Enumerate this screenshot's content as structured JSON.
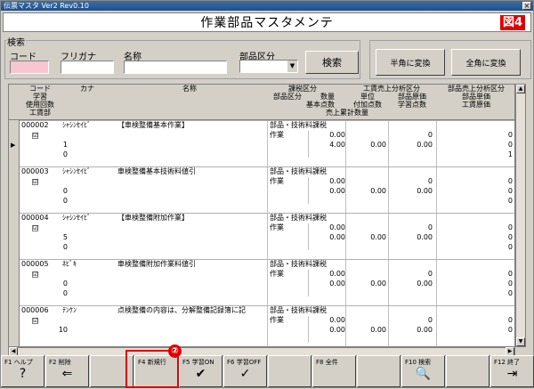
{
  "window": {
    "title": "伝票マスタ Ver2 Rev0.10",
    "close": "×"
  },
  "header": {
    "title": "作業部品マスタメンテ",
    "figure": "図4"
  },
  "search": {
    "group_label": "検索",
    "code_label": "コード",
    "furigana_label": "フリガナ",
    "name_label": "名称",
    "part_label": "部品区分",
    "search_button": "検索",
    "code_value": "",
    "furigana_value": "",
    "name_value": "",
    "part_value": ""
  },
  "convert": {
    "half_button": "半角に変換",
    "full_button": "全角に変換"
  },
  "grid": {
    "headers": {
      "r1": [
        "コード",
        "カナ",
        "名称",
        "課税区分",
        "工賃売上分析区分",
        "部品売上分析区分"
      ],
      "r2": [
        "学習",
        "部品区分",
        "数量",
        "単位",
        "部品原価",
        "部品単価"
      ],
      "r3": [
        "使用回数",
        "基本点数",
        "付加点数",
        "学習点数",
        "工賃原価"
      ],
      "r4": [
        "工賃部",
        "売上累計数量"
      ]
    },
    "records": [
      {
        "code": "000002",
        "kana": "ｼｬｼﾝｾｲﾋﾞ",
        "name": "【車検整備基本作業】",
        "tax": "部品・技術料課税",
        "partkb": "作業",
        "qty": "0.00",
        "n1": "0",
        "n2": "0",
        "row3a": "1",
        "base": "4.00",
        "add": "0.00",
        "learn": "0.00",
        "cost": "0",
        "r4": "0",
        "r4v": "1"
      },
      {
        "code": "000003",
        "kana": "ｼｬｼﾝｾｲﾋﾞ",
        "name": "車検整備基本技術料値引",
        "tax": "部品・技術料課税",
        "partkb": "作業",
        "qty": "0.00",
        "n1": "0",
        "n2": "0",
        "row3a": "0",
        "base": "0.00",
        "add": "0.00",
        "learn": "0.00",
        "cost": "0",
        "r4": "0",
        "r4v": "0"
      },
      {
        "code": "000004",
        "kana": "ｼｬｼﾝｾｲﾋﾞ",
        "name": "【車検整備附加作業】",
        "tax": "部品・技術料課税",
        "partkb": "作業",
        "qty": "0.00",
        "n1": "0",
        "n2": "0",
        "row3a": "5",
        "base": "0.00",
        "add": "0.00",
        "learn": "0.00",
        "cost": "0",
        "r4": "0",
        "r4v": "0"
      },
      {
        "code": "000005",
        "kana": "ﾈﾋﾞｷ",
        "name": "車検整備附加作業料値引",
        "tax": "部品・技術料課税",
        "partkb": "作業",
        "qty": "0.00",
        "n1": "0",
        "n2": "0",
        "row3a": "0",
        "base": "0.00",
        "add": "0.00",
        "learn": "0.00",
        "cost": "0",
        "r4": "0",
        "r4v": "0"
      },
      {
        "code": "000006",
        "kana": "ﾃﾝｹﾝ",
        "name": "点検整備の内容は、分解整備記録簿に記",
        "tax": "部品・技術料課税",
        "partkb": "作業",
        "qty": "0.00",
        "n1": "0",
        "n2": "0",
        "row3a": "10",
        "base": "0.00",
        "add": "0.00",
        "learn": "0.00",
        "cost": "0",
        "r4": "",
        "r4v": ""
      }
    ],
    "check": "☑"
  },
  "fkeys": [
    {
      "key": "F1 ヘルプ",
      "icon": "?"
    },
    {
      "key": "F2 削除",
      "icon": "⇐"
    },
    {
      "key": "",
      "icon": ""
    },
    {
      "key": "F4 新規行",
      "icon": ""
    },
    {
      "key": "F5 学習ON",
      "icon": "✔"
    },
    {
      "key": "F6 学習OFF",
      "icon": "✓"
    },
    {
      "key": "",
      "icon": ""
    },
    {
      "key": "F8 全件",
      "icon": ""
    },
    {
      "key": "",
      "icon": ""
    },
    {
      "key": "F10 検索",
      "icon": "🔍"
    },
    {
      "key": "",
      "icon": ""
    },
    {
      "key": "F12 終了",
      "icon": "⇥"
    }
  ],
  "annotation": {
    "marker": "②"
  },
  "colors": {
    "title": "#1f4f8a",
    "accent": "#e00000",
    "code_input": "#f7c6d0"
  }
}
